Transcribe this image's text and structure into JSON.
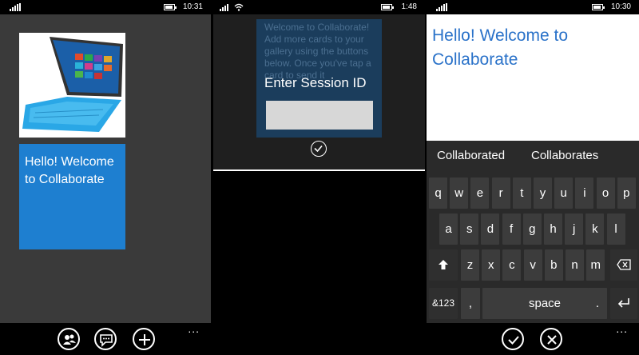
{
  "screen1": {
    "status": {
      "time": "10:31"
    },
    "image_card": {
      "alt": "Surface tablet with blue keyboard cover"
    },
    "text_card": {
      "text": "Hello! Welcome to Collaborate"
    },
    "appbar": {
      "buttons": [
        "people-icon",
        "chat-icon",
        "add-icon"
      ],
      "more": "..."
    }
  },
  "screen2": {
    "status": {
      "time": "1:48"
    },
    "background_text": "Welcome to Collaborate! Add more cards to your gallery using the buttons below. Once you've tap a card to send it",
    "dialog": {
      "title": "Enter Session ID",
      "input_value": "",
      "confirm_icon": "check-icon"
    }
  },
  "screen3": {
    "status": {
      "time": "10:30"
    },
    "editor_text": "Hello! Welcome to Collaborate",
    "suggestions": [
      "Collaborated",
      "Collaborates"
    ],
    "keyboard": {
      "row1": [
        "q",
        "w",
        "e",
        "r",
        "t",
        "y",
        "u",
        "i",
        "o",
        "p"
      ],
      "row2": [
        "a",
        "s",
        "d",
        "f",
        "g",
        "h",
        "j",
        "k",
        "l"
      ],
      "row3": [
        "z",
        "x",
        "c",
        "v",
        "b",
        "n",
        "m"
      ],
      "row4": {
        "symbols": "&123",
        "comma": ",",
        "space": "space",
        "period": "."
      }
    },
    "appbar": {
      "buttons": [
        "check-icon",
        "close-icon"
      ],
      "more": "..."
    }
  },
  "colors": {
    "accent": "#1e7fd0",
    "text_accent": "#2a72c9",
    "dialog_card": "#1b3d5c"
  }
}
